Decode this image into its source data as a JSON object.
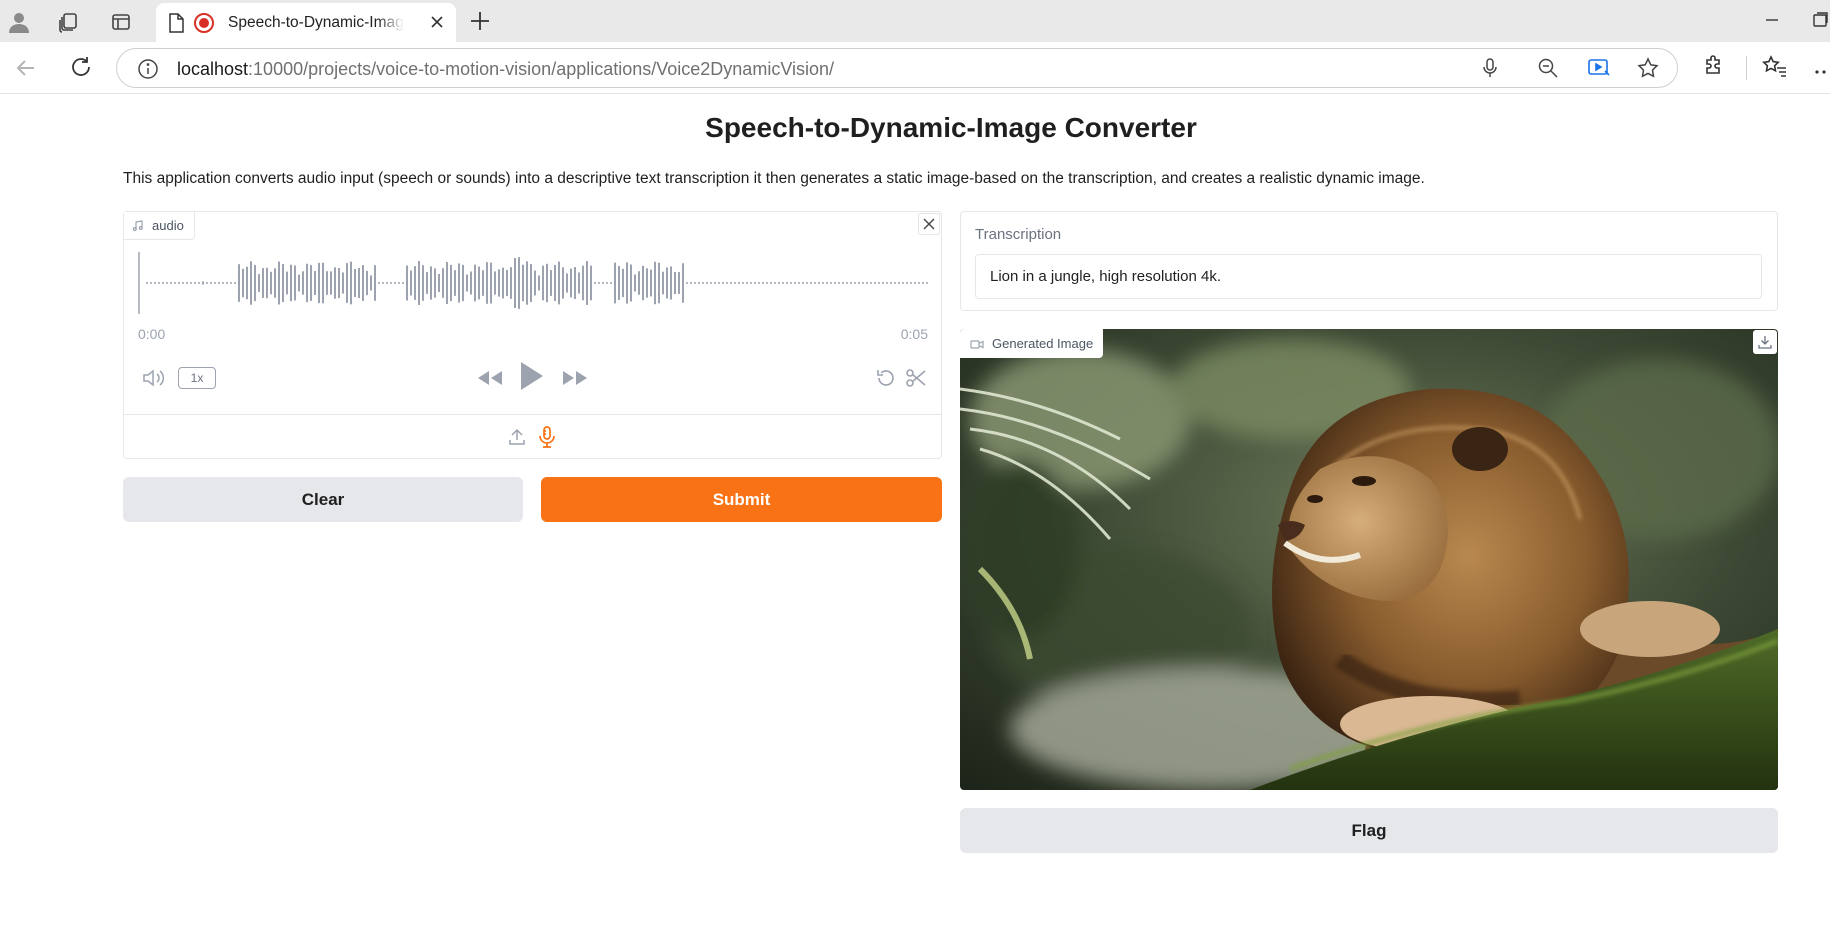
{
  "browser": {
    "tab_title": "Speech-to-Dynamic-Image Converter",
    "url_host": "localhost",
    "url_path": ":10000/projects/voice-to-motion-vision/applications/Voice2DynamicVision/"
  },
  "page": {
    "title": "Speech-to-Dynamic-Image Converter",
    "description": "This application converts audio input (speech or sounds) into a descriptive text transcription it then generates a static image-based on the transcription, and creates a realistic dynamic image."
  },
  "audio": {
    "label": "audio",
    "time_start": "0:00",
    "time_end": "0:05",
    "speed": "1x"
  },
  "buttons": {
    "clear": "Clear",
    "submit": "Submit",
    "flag": "Flag"
  },
  "transcription": {
    "label": "Transcription",
    "value": "Lion in a jungle, high resolution 4k."
  },
  "generated_image": {
    "label": "Generated Image"
  },
  "colors": {
    "accent": "#f97316",
    "secondary_button": "#e5e7eb"
  }
}
